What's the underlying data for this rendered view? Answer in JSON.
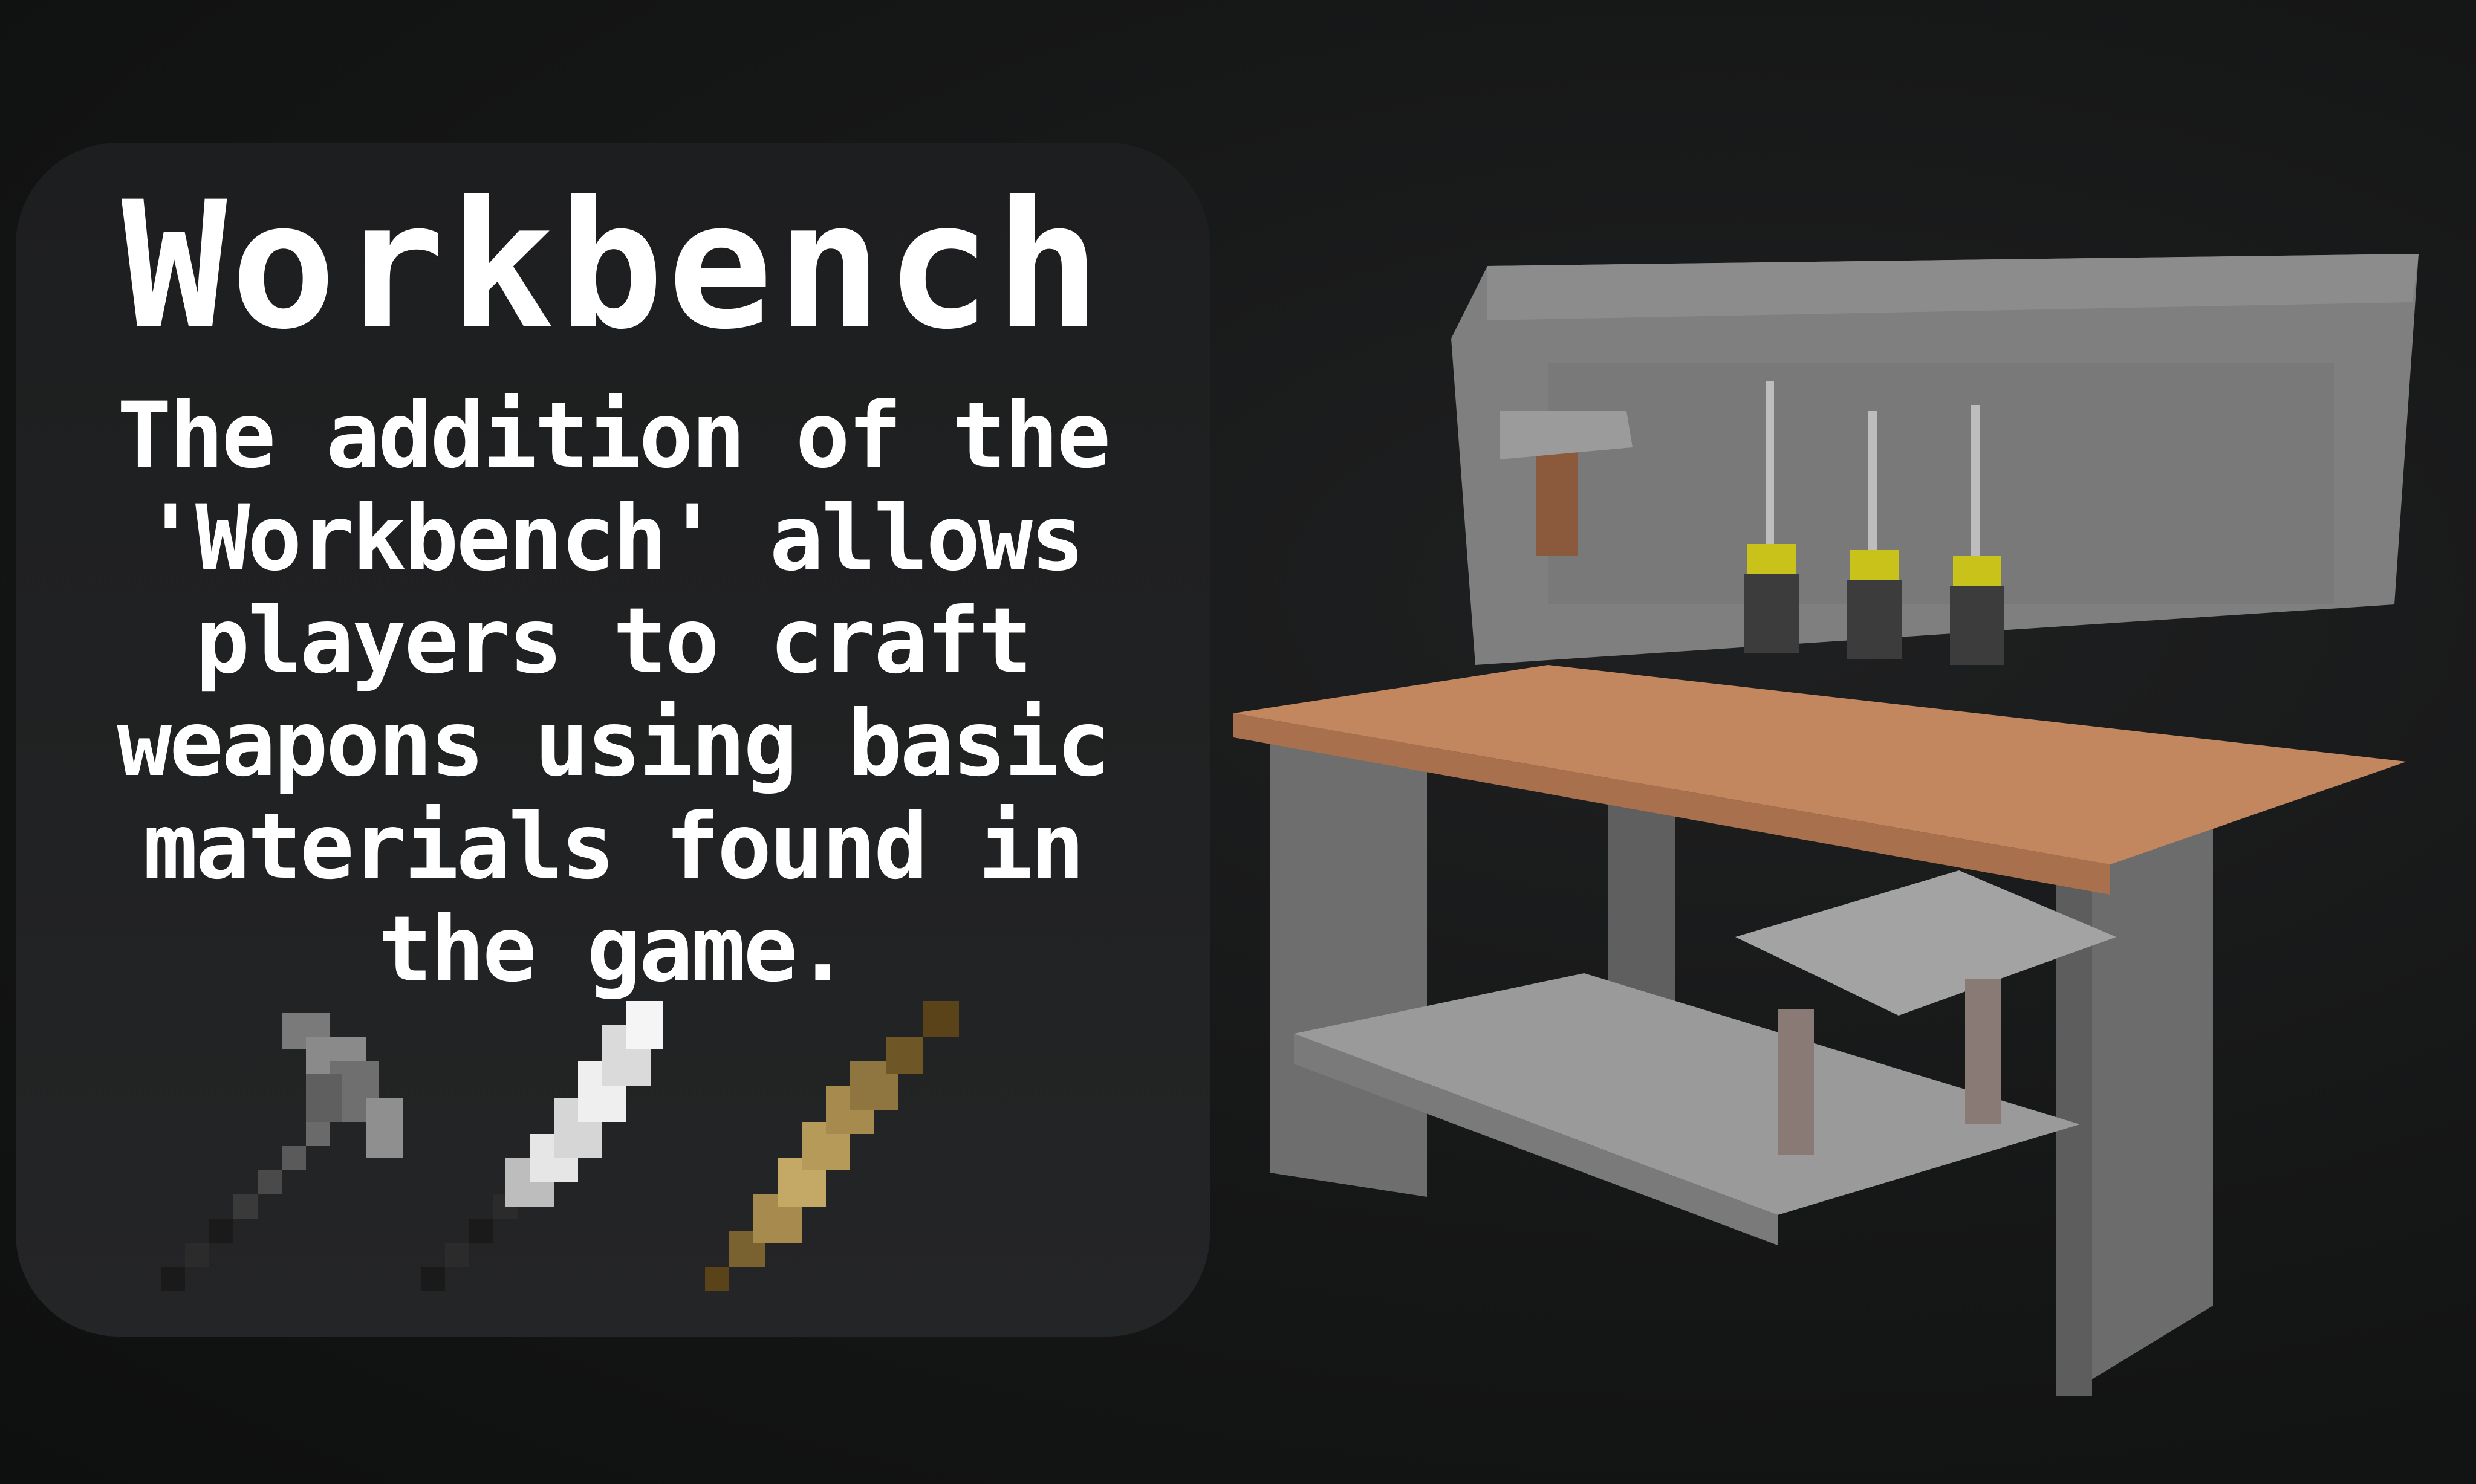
{
  "card": {
    "title": "Workbench",
    "description": "The addition of the 'Workbench' allows players to craft weapons using basic materials found in the game."
  },
  "items": [
    {
      "icon": "hammer-icon",
      "color": "#7a7a7a"
    },
    {
      "icon": "knife-icon",
      "color": "#d9d9d9"
    },
    {
      "icon": "rolling-pin-icon",
      "color": "#b59a5a"
    }
  ],
  "scene": {
    "object": "workbench-model",
    "colors": {
      "frame": "#7d7d7d",
      "frame_dark": "#5a5a5a",
      "top_wood": "#c38760",
      "handle_yellow": "#c8c21a"
    },
    "tools_on_pegboard": [
      "hammer-icon",
      "screwdriver-icon",
      "screwdriver-icon",
      "screwdriver-icon"
    ]
  }
}
